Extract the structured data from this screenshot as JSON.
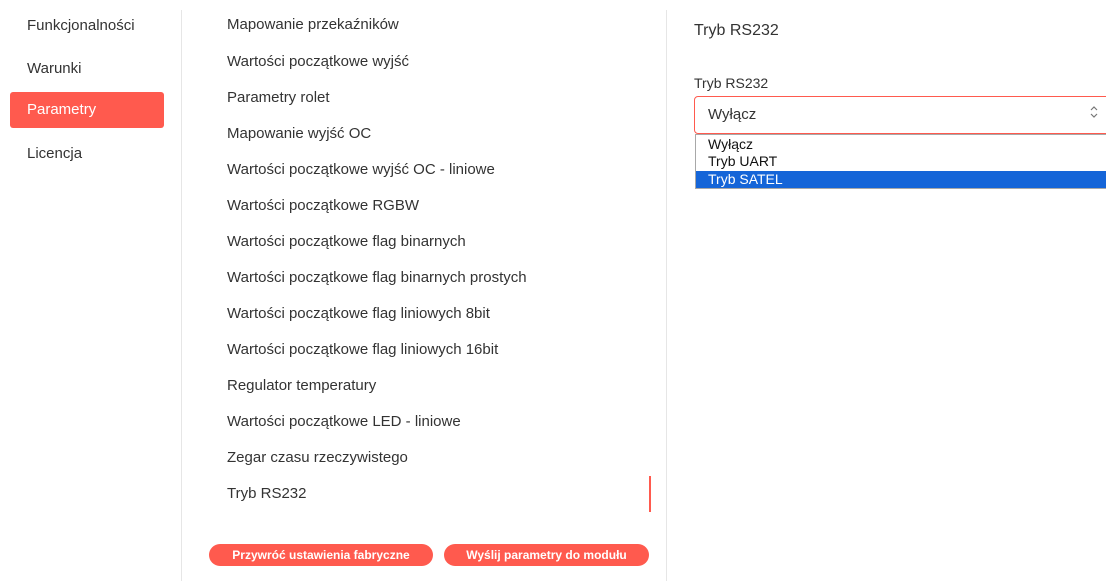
{
  "nav": {
    "items": [
      {
        "label": "Funkcjonalności",
        "active": false
      },
      {
        "label": "Warunki",
        "active": false
      },
      {
        "label": "Parametry",
        "active": true
      },
      {
        "label": "Licencja",
        "active": false
      }
    ]
  },
  "params": {
    "items": [
      {
        "label": "Mapowanie przekaźników"
      },
      {
        "label": "Wartości początkowe wyjść"
      },
      {
        "label": "Parametry rolet"
      },
      {
        "label": "Mapowanie wyjść OC"
      },
      {
        "label": "Wartości początkowe wyjść OC - liniowe"
      },
      {
        "label": "Wartości początkowe RGBW"
      },
      {
        "label": "Wartości początkowe flag binarnych"
      },
      {
        "label": "Wartości początkowe flag binarnych prostych"
      },
      {
        "label": "Wartości początkowe flag liniowych 8bit"
      },
      {
        "label": "Wartości początkowe flag liniowych 16bit"
      },
      {
        "label": "Regulator temperatury"
      },
      {
        "label": "Wartości początkowe LED - liniowe"
      },
      {
        "label": "Zegar czasu rzeczywistego"
      },
      {
        "label": "Tryb RS232",
        "active": true
      }
    ],
    "reset_button": "Przywróć ustawienia fabryczne",
    "send_button": "Wyślij parametry do modułu"
  },
  "detail": {
    "title": "Tryb RS232",
    "field_label": "Tryb RS232",
    "select_value": "Wyłącz",
    "arrow_icon": "⌃⌄",
    "options": [
      {
        "label": "Wyłącz",
        "highlighted": false
      },
      {
        "label": "Tryb UART",
        "highlighted": false
      },
      {
        "label": "Tryb SATEL",
        "highlighted": true
      }
    ]
  },
  "colors": {
    "accent": "#ff5a4e",
    "option_highlight": "#1565d8"
  }
}
